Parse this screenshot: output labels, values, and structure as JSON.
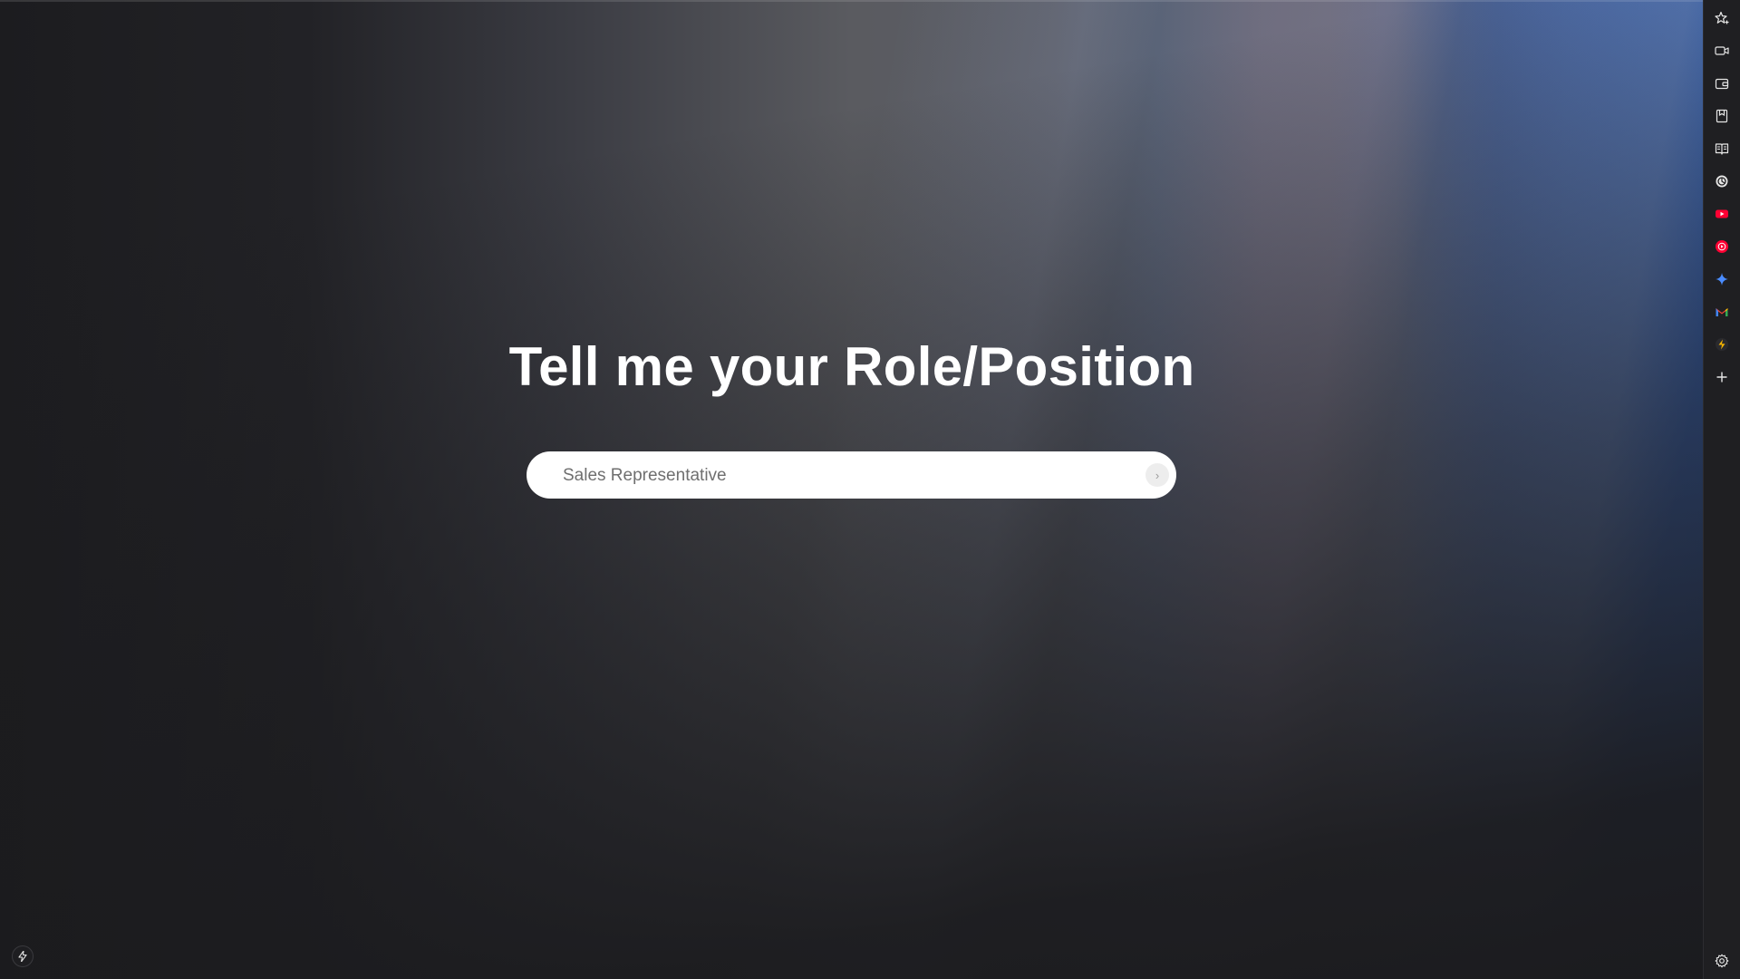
{
  "main": {
    "heading": "Tell me your Role/Position",
    "input_placeholder": "Sales Representative",
    "submit_glyph": "›"
  },
  "sidebar": {
    "items": [
      {
        "name": "sparkle-star-icon"
      },
      {
        "name": "video-camera-icon"
      },
      {
        "name": "wallet-icon"
      },
      {
        "name": "bookmark-save-icon"
      },
      {
        "name": "reader-book-icon"
      },
      {
        "name": "chatgpt-icon"
      },
      {
        "name": "youtube-icon",
        "color": "#ff0033"
      },
      {
        "name": "youtube-music-icon",
        "color": "#ff0033"
      },
      {
        "name": "gemini-sparkle-icon",
        "color": "#4a8cff"
      },
      {
        "name": "gmail-icon"
      },
      {
        "name": "bolt-app-icon",
        "color": "#f5b400"
      },
      {
        "name": "add-icon"
      },
      {
        "name": "settings-gear-icon"
      }
    ]
  },
  "footer": {
    "bolt_icon": "lightning-bolt-icon"
  }
}
